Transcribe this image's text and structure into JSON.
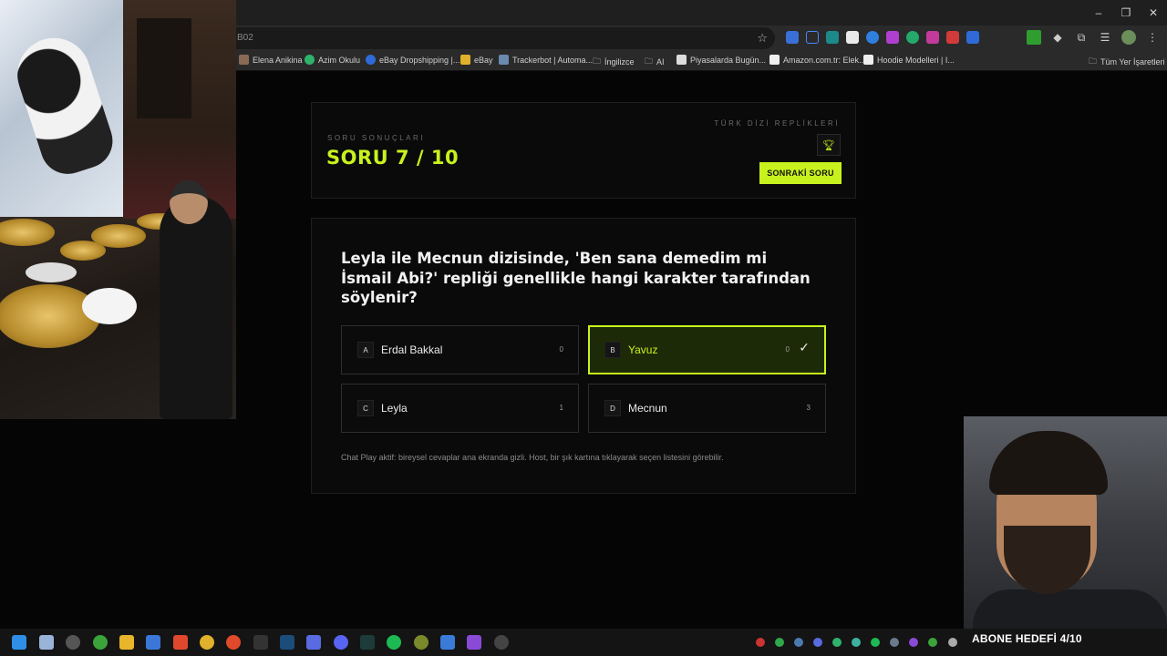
{
  "browser": {
    "url_fragment": "B02",
    "window_controls": [
      "–",
      "❐",
      "✕"
    ]
  },
  "bookmarks": {
    "items": [
      "Elena Anikina",
      "Azim Okulu",
      "eBay Dropshipping |...",
      "eBay",
      "Trackerbot | Automa...",
      "İngilizce",
      "AI",
      "Piyasalarda Bugün...",
      "Amazon.com.tr: Elek...",
      "Hoodie Modelleri | I..."
    ],
    "all_bookmarks": "Tüm Yer İşaretleri"
  },
  "header": {
    "kicker": "SORU SONUÇLARI",
    "title": "SORU 7 / 10",
    "category": "TÜRK DİZİ REPLİKLERİ",
    "next_button": "SONRAKİ SORU"
  },
  "quiz": {
    "question": "Leyla ile Mecnun dizisinde, 'Ben sana demedim mi İsmail Abi?' repliği genellikle hangi karakter tarafından söylenir?",
    "options": [
      {
        "letter": "A",
        "text": "Erdal Bakkal",
        "count": "0",
        "correct": false
      },
      {
        "letter": "B",
        "text": "Yavuz",
        "count": "0",
        "correct": true
      },
      {
        "letter": "C",
        "text": "Leyla",
        "count": "1",
        "correct": false
      },
      {
        "letter": "D",
        "text": "Mecnun",
        "count": "3",
        "correct": false
      }
    ],
    "note": "Chat Play aktif: bireysel cevaplar ana ekranda gizli. Host, bir şık kartına tıklayarak seçen listesini görebilir."
  },
  "overlay": {
    "subscriber_goal": "ABONE HEDEFİ 4/10"
  },
  "colors": {
    "accent": "#c8f21d",
    "background": "#050505",
    "card": "#0a0a0a"
  }
}
